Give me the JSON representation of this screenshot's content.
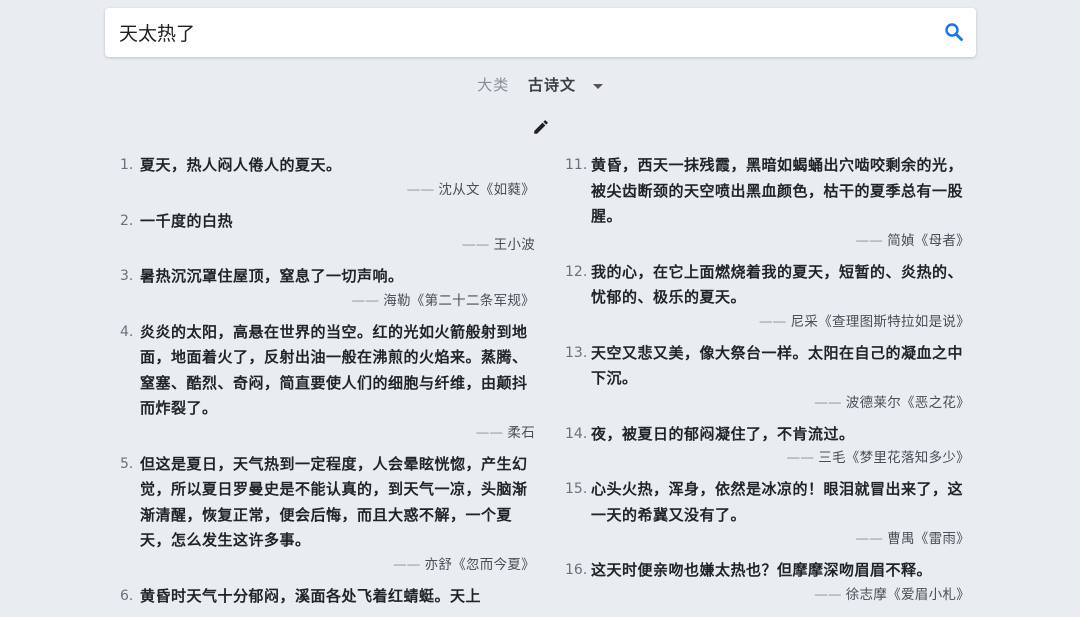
{
  "search": {
    "value": "天太热了"
  },
  "category": {
    "label": "大类",
    "value": "古诗文"
  },
  "left_quotes": [
    {
      "num": "1.",
      "text": "夏天，热人闷人倦人的夏天。",
      "source": "沈从文《如蕤》"
    },
    {
      "num": "2.",
      "text": "一千度的白热",
      "source": "王小波"
    },
    {
      "num": "3.",
      "text": "暑热沉沉罩住屋顶，窒息了一切声响。",
      "source": "海勒《第二十二条军规》"
    },
    {
      "num": "4.",
      "text": "炎炎的太阳，高悬在世界的当空。红的光如火箭般射到地面，地面着火了，反射出油一般在沸煎的火焰来。蒸腾、窒塞、酷烈、奇闷，简直要使人们的细胞与纤维，由颠抖而炸裂了。",
      "source": "柔石"
    },
    {
      "num": "5.",
      "text": "但这是夏日，天气热到一定程度，人会晕眩恍惚，产生幻觉，所以夏日罗曼史是不能认真的，到天气一凉，头脑渐渐清醒，恢复正常，便会后悔，而且大惑不解，一个夏天，怎么发生这许多事。",
      "source": "亦舒《忽而今夏》"
    },
    {
      "num": "6.",
      "text": "黄昏时天气十分郁闷，溪面各处飞着红蜻蜓。天上",
      "source": ""
    }
  ],
  "right_quotes": [
    {
      "num": "11.",
      "text": "黄昏，西天一抹残霞，黑暗如蝎蛹出穴啮咬剩余的光，被尖齿断颈的天空喷出黑血颜色，枯干的夏季总有一股腥。",
      "source": "简媜《母者》"
    },
    {
      "num": "12.",
      "text": "我的心，在它上面燃烧着我的夏天，短暂的、炎热的、忧郁的、极乐的夏天。",
      "source": "尼采《查理图斯特拉如是说》"
    },
    {
      "num": "13.",
      "text": "天空又悲又美，像大祭台一样。太阳在自己的凝血之中下沉。",
      "source": "波德莱尔《恶之花》"
    },
    {
      "num": "14.",
      "text": "夜，被夏日的郁闷凝住了，不肯流过。",
      "source": "三毛《梦里花落知多少》"
    },
    {
      "num": "15.",
      "text": "心头火热，浑身，依然是冰凉的！眼泪就冒出来了，这一天的希冀又没有了。",
      "source": "曹禺《雷雨》"
    },
    {
      "num": "16.",
      "text": "这天时便亲吻也嫌太热也？但摩摩深吻眉眉不释。",
      "source": "徐志摩《爱眉小札》"
    }
  ],
  "source_dash": "——",
  "icons": {
    "search": "search-icon",
    "edit": "pencil-icon",
    "dropdown": "caret-down-icon"
  },
  "colors": {
    "accent": "#1a73e8",
    "background": "#e9edf1"
  }
}
